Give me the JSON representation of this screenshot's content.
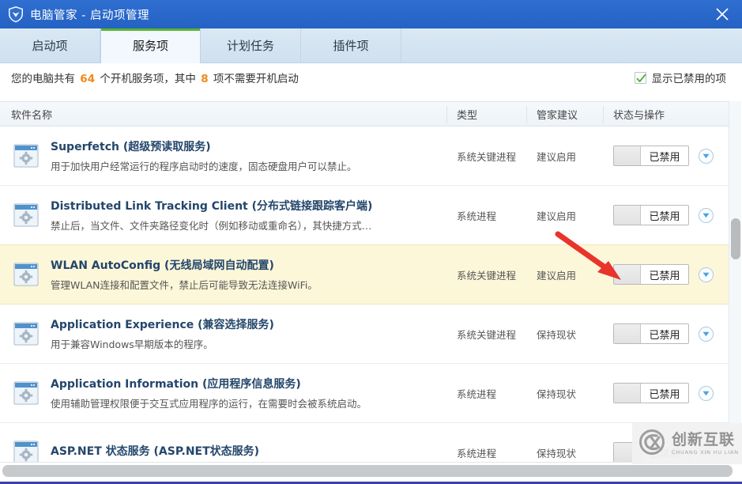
{
  "window": {
    "title": "电脑管家 - 启动项管理",
    "logo_icon": "shield-icon",
    "close_icon": "close-icon"
  },
  "tabs": [
    {
      "label": "启动项",
      "active": false
    },
    {
      "label": "服务项",
      "active": true
    },
    {
      "label": "计划任务",
      "active": false
    },
    {
      "label": "插件项",
      "active": false
    }
  ],
  "info": {
    "prefix": "您的电脑共有",
    "total": "64",
    "middle": "个开机服务项，其中",
    "disabled_count": "8",
    "suffix": "项不需要开机启动",
    "checkbox_label": "显示已禁用的项",
    "checkbox_checked": true,
    "check_icon": "checkmark-icon"
  },
  "columns": {
    "name": "软件名称",
    "type": "类型",
    "advice": "管家建议",
    "status": "状态与操作"
  },
  "rows": [
    {
      "icon": "service-gear-icon",
      "name_en": "Superfetch",
      "name_cn": "(超级预读取服务)",
      "desc": "用于加快用户经常运行的程序启动时的速度，固态硬盘用户可以禁止。",
      "type": "系统关键进程",
      "advice": "建议启用",
      "toggle_label": "已禁用",
      "dropdown_icon": "chevron-down-icon",
      "highlight": false
    },
    {
      "icon": "service-gear-icon",
      "name_en": "Distributed Link Tracking Client",
      "name_cn": "(分布式链接跟踪客户端)",
      "desc": "禁止后，当文件、文件夹路径变化时（例如移动或重命名），其快捷方式…",
      "type": "系统进程",
      "advice": "建议启用",
      "toggle_label": "已禁用",
      "dropdown_icon": "chevron-down-icon",
      "highlight": false
    },
    {
      "icon": "service-gear-icon",
      "name_en": "WLAN AutoConfig",
      "name_cn": "(无线局域网自动配置)",
      "desc": "管理WLAN连接和配置文件，禁止后可能导致无法连接WiFi。",
      "type": "系统关键进程",
      "advice": "建议启用",
      "toggle_label": "已禁用",
      "dropdown_icon": "chevron-down-icon",
      "highlight": true
    },
    {
      "icon": "service-gear-icon",
      "name_en": "Application Experience",
      "name_cn": "(兼容选择服务)",
      "desc": "用于兼容Windows早期版本的程序。",
      "type": "系统关键进程",
      "advice": "保持现状",
      "toggle_label": "已禁用",
      "dropdown_icon": "chevron-down-icon",
      "highlight": false
    },
    {
      "icon": "service-gear-icon",
      "name_en": "Application Information",
      "name_cn": "(应用程序信息服务)",
      "desc": "使用辅助管理权限便于交互式应用程序的运行，在需要时会被系统启动。",
      "type": "系统进程",
      "advice": "保持现状",
      "toggle_label": "已禁用",
      "dropdown_icon": "chevron-down-icon",
      "highlight": false
    },
    {
      "icon": "service-gear-icon",
      "name_en": "ASP.NET 状态服务",
      "name_cn": "(ASP.NET状态服务)",
      "desc": "",
      "type": "系统进程",
      "advice": "保持现状",
      "toggle_label": "已禁用",
      "dropdown_icon": "chevron-down-icon",
      "highlight": false
    }
  ],
  "annotation": {
    "arrow_color": "#e8342a",
    "arrow_name": "red-arrow-pointer"
  },
  "watermark": {
    "cn": "创新互联",
    "en": "CHUANG XIN HU LIAN",
    "logo_icon": "cx-circle-logo-icon"
  },
  "colors": {
    "titlebar": "#2462c4",
    "tab_active_underline": "#5cb531",
    "highlight_row": "#fdf7d9",
    "accent_number": "#f08a1c"
  }
}
